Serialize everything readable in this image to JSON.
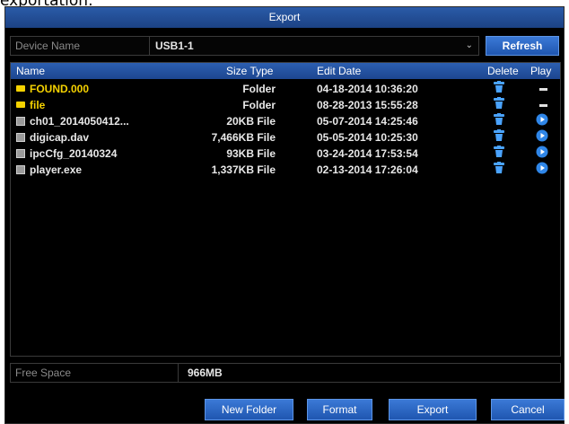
{
  "page": {
    "top_caption": "exportation:"
  },
  "dialog": {
    "title": "Export"
  },
  "device": {
    "label": "Device Name",
    "value": "USB1-1",
    "refresh": "Refresh"
  },
  "columns": {
    "name": "Name",
    "size_type": "Size Type",
    "edit_date": "Edit Date",
    "delete": "Delete",
    "play": "Play"
  },
  "files": [
    {
      "name": "FOUND.000",
      "size_type": "Folder",
      "date": "04-18-2014 10:36:20",
      "kind": "folder",
      "play": "none"
    },
    {
      "name": "file",
      "size_type": "Folder",
      "date": "08-28-2013 15:55:28",
      "kind": "folder",
      "play": "none"
    },
    {
      "name": "ch01_2014050412...",
      "size_type": "20KB File",
      "date": "05-07-2014 14:25:46",
      "kind": "file",
      "play": "play"
    },
    {
      "name": "digicap.dav",
      "size_type": "7,466KB File",
      "date": "05-05-2014 10:25:30",
      "kind": "file",
      "play": "play"
    },
    {
      "name": "ipcCfg_20140324",
      "size_type": "93KB File",
      "date": "03-24-2014 17:53:54",
      "kind": "file",
      "play": "play"
    },
    {
      "name": "player.exe",
      "size_type": "1,337KB File",
      "date": "02-13-2014 17:26:04",
      "kind": "file",
      "play": "play"
    }
  ],
  "free_space": {
    "label": "Free Space",
    "value": "966MB"
  },
  "buttons": {
    "new_folder": "New Folder",
    "format": "Format",
    "export": "Export",
    "cancel": "Cancel"
  },
  "colors": {
    "accent": "#2a5ba8",
    "folder_text": "#f5d200",
    "icon_blue": "#4aa3ff"
  }
}
